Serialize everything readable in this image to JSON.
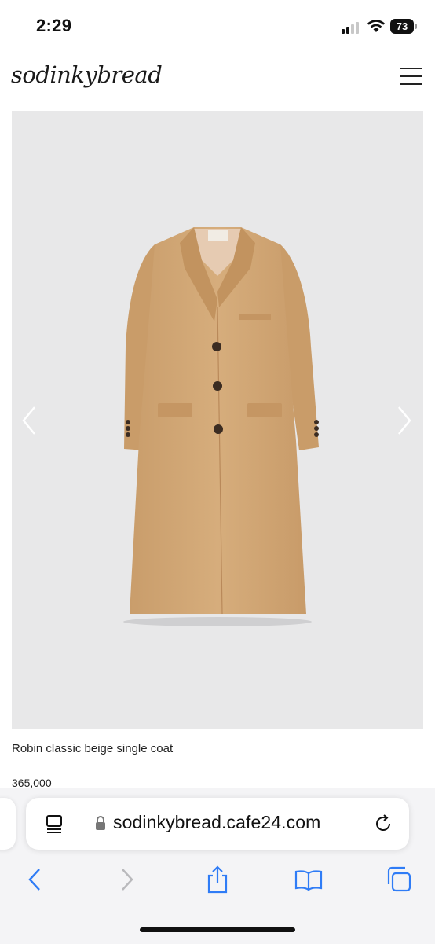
{
  "status_bar": {
    "time": "2:29",
    "battery_level": "73",
    "signal_bars_active": 2,
    "signal_bars_total": 4
  },
  "site": {
    "logo_text": "sodinkybread",
    "menu_icon": "hamburger-menu-icon"
  },
  "product": {
    "name": "Robin classic beige single coat",
    "price": "365,000",
    "image_bg_color": "#e8e8e9",
    "coat_color": "#d2a877",
    "prev_icon": "chevron-left-icon",
    "next_icon": "chevron-right-icon"
  },
  "browser": {
    "url": "sodinkybread.cafe24.com",
    "accent_color": "#2f7cf6",
    "icons": {
      "reader": "reader-mode-icon",
      "lock": "lock-icon",
      "reload": "reload-icon",
      "back": "back-arrow-icon",
      "forward": "forward-arrow-icon",
      "share": "share-icon",
      "bookmarks": "bookmarks-icon",
      "tabs": "tabs-icon"
    }
  }
}
